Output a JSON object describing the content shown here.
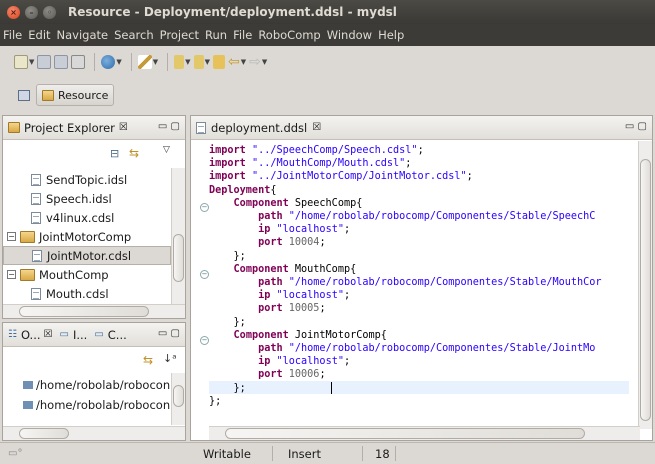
{
  "window": {
    "title": "Resource - Deployment/deployment.ddsl - mydsl"
  },
  "menu": [
    "File",
    "Edit",
    "Navigate",
    "Search",
    "Project",
    "Run",
    "File",
    "RoboComp",
    "Window",
    "Help"
  ],
  "perspective": {
    "label": "Resource"
  },
  "project_explorer": {
    "title": "Project Explorer",
    "items": [
      {
        "label": "SendTopic.idsl",
        "kind": "file"
      },
      {
        "label": "Speech.idsl",
        "kind": "file"
      },
      {
        "label": "v4linux.cdsl",
        "kind": "file"
      },
      {
        "label": "JointMotorComp",
        "kind": "project"
      },
      {
        "label": "JointMotor.cdsl",
        "kind": "file",
        "selected": true
      },
      {
        "label": "MouthComp",
        "kind": "project"
      },
      {
        "label": "Mouth.cdsl",
        "kind": "file"
      }
    ]
  },
  "outline": {
    "tabs": [
      "O...",
      "I...",
      "C..."
    ],
    "items": [
      "/home/robolab/robocon",
      "/home/robolab/robocon"
    ]
  },
  "editor": {
    "tab": "deployment.ddsl",
    "lines": [
      [
        [
          "kw",
          "import"
        ],
        [
          "t",
          " "
        ],
        [
          "str",
          "\"../SpeechComp/Speech.cdsl\""
        ],
        [
          "t",
          ";"
        ]
      ],
      [
        [
          "kw",
          "import"
        ],
        [
          "t",
          " "
        ],
        [
          "str",
          "\"../MouthComp/Mouth.cdsl\""
        ],
        [
          "t",
          ";"
        ]
      ],
      [
        [
          "kw",
          "import"
        ],
        [
          "t",
          " "
        ],
        [
          "str",
          "\"../JointMotorComp/JointMotor.cdsl\""
        ],
        [
          "t",
          ";"
        ]
      ],
      [
        [
          "kw",
          "Deployment"
        ],
        [
          "t",
          "{"
        ]
      ],
      [
        [
          "t",
          "    "
        ],
        [
          "kw",
          "Component"
        ],
        [
          "t",
          " SpeechComp{"
        ]
      ],
      [
        [
          "t",
          "        "
        ],
        [
          "kw",
          "path"
        ],
        [
          "t",
          " "
        ],
        [
          "str",
          "\"/home/robolab/robocomp/Componentes/Stable/SpeechC"
        ]
      ],
      [
        [
          "t",
          "        "
        ],
        [
          "kw",
          "ip"
        ],
        [
          "t",
          " "
        ],
        [
          "str",
          "\"localhost\""
        ],
        [
          "t",
          ";"
        ]
      ],
      [
        [
          "t",
          "        "
        ],
        [
          "kw",
          "port"
        ],
        [
          "t",
          " "
        ],
        [
          "num",
          "10004"
        ],
        [
          "t",
          ";"
        ]
      ],
      [
        [
          "t",
          "    };"
        ]
      ],
      [
        [
          "t",
          "    "
        ],
        [
          "kw",
          "Component"
        ],
        [
          "t",
          " MouthComp{"
        ]
      ],
      [
        [
          "t",
          "        "
        ],
        [
          "kw",
          "path"
        ],
        [
          "t",
          " "
        ],
        [
          "str",
          "\"/home/robolab/robocomp/Componentes/Stable/MouthCor"
        ]
      ],
      [
        [
          "t",
          "        "
        ],
        [
          "kw",
          "ip"
        ],
        [
          "t",
          " "
        ],
        [
          "str",
          "\"localhost\""
        ],
        [
          "t",
          ";"
        ]
      ],
      [
        [
          "t",
          "        "
        ],
        [
          "kw",
          "port"
        ],
        [
          "t",
          " "
        ],
        [
          "num",
          "10005"
        ],
        [
          "t",
          ";"
        ]
      ],
      [
        [
          "t",
          "    };"
        ]
      ],
      [
        [
          "t",
          "    "
        ],
        [
          "kw",
          "Component"
        ],
        [
          "t",
          " JointMotorComp{"
        ]
      ],
      [
        [
          "t",
          "        "
        ],
        [
          "kw",
          "path"
        ],
        [
          "t",
          " "
        ],
        [
          "str",
          "\"/home/robolab/robocomp/Componentes/Stable/JointMo"
        ]
      ],
      [
        [
          "t",
          "        "
        ],
        [
          "kw",
          "ip"
        ],
        [
          "t",
          " "
        ],
        [
          "str",
          "\"localhost\""
        ],
        [
          "t",
          ";"
        ]
      ],
      [
        [
          "t",
          "        "
        ],
        [
          "kw",
          "port"
        ],
        [
          "t",
          " "
        ],
        [
          "num",
          "10006"
        ],
        [
          "t",
          ";"
        ]
      ],
      [
        [
          "t",
          "    };"
        ]
      ],
      [
        [
          "t",
          "};"
        ]
      ]
    ]
  },
  "status": {
    "writable": "Writable",
    "insert": "Insert",
    "position": "18"
  }
}
